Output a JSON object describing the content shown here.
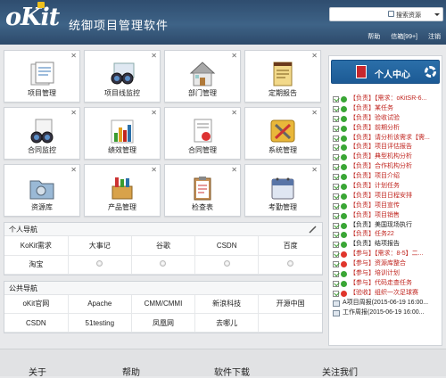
{
  "app": {
    "logo": "oKit",
    "title": "统御项目管理软件"
  },
  "search": {
    "placeholder": "",
    "button": "搜索资源"
  },
  "top_links": [
    "帮助",
    "信箱[99+]",
    "注销"
  ],
  "tiles": [
    {
      "label": "项目管理",
      "icon": "project-icon"
    },
    {
      "label": "项目线监控",
      "icon": "binoculars-icon"
    },
    {
      "label": "部门管理",
      "icon": "house-icon"
    },
    {
      "label": "定期报告",
      "icon": "report-icon"
    },
    {
      "label": "合同监控",
      "icon": "contract-monitor-icon"
    },
    {
      "label": "绩效管理",
      "icon": "chart-icon"
    },
    {
      "label": "合同管理",
      "icon": "contract-icon"
    },
    {
      "label": "系统管理",
      "icon": "tools-icon"
    },
    {
      "label": "资源库",
      "icon": "folder-icon"
    },
    {
      "label": "产品管理",
      "icon": "box-icon"
    },
    {
      "label": "检查表",
      "icon": "checklist-icon"
    },
    {
      "label": "考勤管理",
      "icon": "calendar-icon"
    }
  ],
  "personal_nav": {
    "title": "个人导航",
    "rows": [
      [
        "KoKit需求",
        "大事记",
        "谷歌",
        "CSDN",
        "百度"
      ],
      [
        "淘宝",
        "",
        "",
        "",
        ""
      ]
    ]
  },
  "public_nav": {
    "title": "公共导航",
    "rows": [
      [
        "oKit官网",
        "Apache",
        "CMM/CMMI",
        "新浪科技",
        "开源中国"
      ],
      [
        "CSDN",
        "51testing",
        "凤凰网",
        "去哪儿",
        ""
      ]
    ]
  },
  "user_center": {
    "label": "个人中心"
  },
  "tasks": [
    {
      "text": "【负责】【需求：oKitSR-6...",
      "status": "green"
    },
    {
      "text": "【负责】某任务",
      "status": "green"
    },
    {
      "text": "【负责】验收试验",
      "status": "green"
    },
    {
      "text": "【负责】前期分析",
      "status": "green"
    },
    {
      "text": "【负责】请分析该需求【需...",
      "status": "green"
    },
    {
      "text": "【负责】项目评估报告",
      "status": "green"
    },
    {
      "text": "【负责】典型机构分析",
      "status": "green"
    },
    {
      "text": "【负责】合作机构分析",
      "status": "green"
    },
    {
      "text": "【负责】项目介绍",
      "status": "green"
    },
    {
      "text": "【负责】计划任务",
      "status": "green"
    },
    {
      "text": "【负责】项目日程安排",
      "status": "green"
    },
    {
      "text": "【负责】项目宣传",
      "status": "green"
    },
    {
      "text": "【负责】项目销售",
      "status": "green"
    },
    {
      "text": "【负责】美国现场执行",
      "status": "green",
      "plain_tail": true
    },
    {
      "text": "【负责】任务22",
      "status": "green"
    },
    {
      "text": "【负责】结项报告",
      "status": "green",
      "plain_tail": true
    },
    {
      "text": "【参与】【需求：8-5】二...",
      "status": "red"
    },
    {
      "text": "【参与】资源库整合",
      "status": "red"
    },
    {
      "text": "【参与】培训计划",
      "status": "green"
    },
    {
      "text": "【参与】代码走查任务",
      "status": "green"
    },
    {
      "text": "【验收】组织一次足球赛",
      "status": "red"
    },
    {
      "text": "A项目周报(2015-06-19 16:00...",
      "status": "doc"
    },
    {
      "text": "工作周报(2015-06-19 16:00...",
      "status": "doc"
    }
  ],
  "footer": [
    "关于",
    "帮助",
    "软件下载",
    "关注我们"
  ],
  "colors": {
    "header": "#345578",
    "accent": "#1f5f99",
    "task_red": "#c0251f"
  }
}
